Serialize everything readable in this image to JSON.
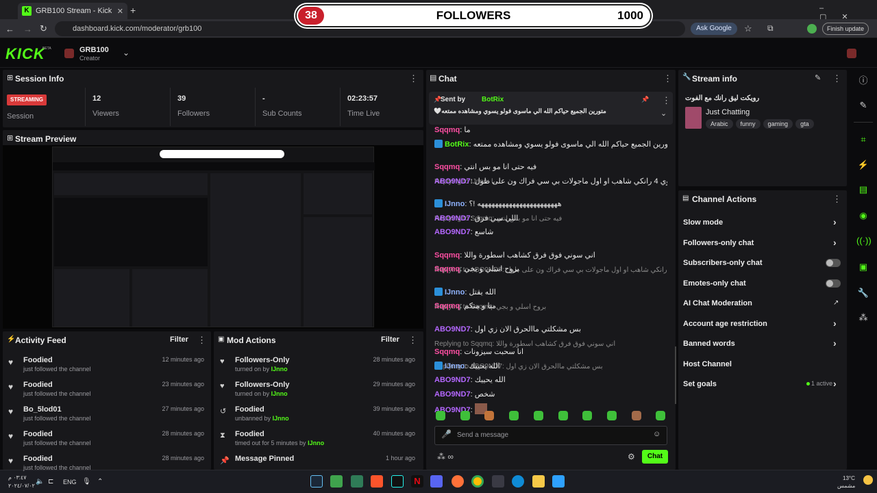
{
  "browser": {
    "tab_title": "GRB100 Stream - Kick Dashboard",
    "url": "dashboard.kick.com/moderator/grb100",
    "ask_google": "Ask Google",
    "finish_update": "Finish update"
  },
  "overlay": {
    "count": "38",
    "label": "FOLLOWERS",
    "goal": "1000"
  },
  "header": {
    "logo": "KICK",
    "logo_sub": "BETA",
    "channel": "GRB100",
    "role": "Creator"
  },
  "session": {
    "title": "Session Info",
    "status": "STREAMING",
    "session_label": "Session",
    "stats": [
      {
        "value": "12",
        "label": "Viewers"
      },
      {
        "value": "39",
        "label": "Followers"
      },
      {
        "value": "-",
        "label": "Sub Counts"
      },
      {
        "value": "02:23:57",
        "label": "Time Live"
      }
    ]
  },
  "preview": {
    "title": "Stream Preview"
  },
  "activity": {
    "title": "Activity Feed",
    "filter": "Filter",
    "items": [
      {
        "name": "Foodied",
        "desc": "just followed the channel",
        "time": "12 minutes ago"
      },
      {
        "name": "Foodied",
        "desc": "just followed the channel",
        "time": "23 minutes ago"
      },
      {
        "name": "Bo_5lod01",
        "desc": "just followed the channel",
        "time": "27 minutes ago"
      },
      {
        "name": "Foodied",
        "desc": "just followed the channel",
        "time": "28 minutes ago"
      },
      {
        "name": "Foodied",
        "desc": "just followed the channel",
        "time": "28 minutes ago"
      }
    ]
  },
  "mod": {
    "title": "Mod Actions",
    "filter": "Filter",
    "items": [
      {
        "name": "Followers-Only",
        "desc": "turned on by",
        "by": "IJnno",
        "time": "28 minutes ago"
      },
      {
        "name": "Followers-Only",
        "desc": "turned on by",
        "by": "IJnno",
        "time": "29 minutes ago"
      },
      {
        "name": "Foodied",
        "desc": "unbanned by",
        "by": "IJnno",
        "time": "39 minutes ago"
      },
      {
        "name": "Foodied",
        "desc": "timed out for 5 minutes by",
        "by": "IJnno",
        "time": "40 minutes ago"
      },
      {
        "name": "Message Pinned",
        "desc": "",
        "by": "",
        "time": "1 hour ago"
      }
    ]
  },
  "chat": {
    "title": "Chat",
    "pinned_by_label": "Sent by",
    "pinned_user": "BotRix",
    "pinned_text": "متورين الجميع حياكم الله الي ماسوى فولو يسوي ومشاهده ممتعه🤍",
    "messages": [
      {
        "type": "msg",
        "user": "Sqqmq",
        "cls": "u-pink",
        "text": "ما"
      },
      {
        "type": "msg",
        "user": "BotRix",
        "cls": "u-green",
        "text": "متورين الجميع حياكم الله الي ماسوى فولو يسوي ومشاهده ممتعه🤍"
      },
      {
        "type": "reply",
        "text": "Replying to IJnno: يا"
      },
      {
        "type": "msg",
        "user": "Sqqmq",
        "cls": "u-pink",
        "text": "فيه حتى انا مو بس انتي"
      },
      {
        "type": "msg",
        "user": "ABO9ND7",
        "cls": "u-purple",
        "text": "انا كنت سوي 4 رانكي شاهب او اول ماجولات بي سي فراك ون على طول"
      },
      {
        "type": "reply",
        "text": "Replying to Sqqmq: فيه حتى انا مو بس انتي"
      },
      {
        "type": "msg",
        "user": "IJnno",
        "cls": "u-blue",
        "text": "هههههههههههههههههههههههه !؟"
      },
      {
        "type": "msg",
        "user": "ABO9ND7",
        "cls": "u-purple",
        "text": "اللي سي فرق"
      },
      {
        "type": "msg",
        "user": "ABO9ND7",
        "cls": "u-purple",
        "text": "شاسع"
      },
      {
        "type": "reply",
        "text": "Replying to ABO9ND7: انا كنت سوي 4 رانكي شاهب او اول ماجولات بي سي فراك ون على طول"
      },
      {
        "type": "msg",
        "user": "Sqqmq",
        "cls": "u-pink",
        "text": "اني سوني فوق فرق كشاهب اسطورة واللا"
      },
      {
        "type": "msg",
        "user": "Sqqmq",
        "cls": "u-pink",
        "text": "بروح اسلي و بجي"
      },
      {
        "type": "reply",
        "text": "Replying to Sqqmq: بروح اسلي و بجي"
      },
      {
        "type": "msg",
        "user": "IJnno",
        "cls": "u-blue",
        "text": "الله يقتل"
      },
      {
        "type": "msg",
        "user": "Sqqmq",
        "cls": "u-pink",
        "text": "منا و منكم"
      },
      {
        "type": "reply",
        "text": "Replying to Sqqmq: اني سوني فوق فرق كشاهب اسطورة واللا"
      },
      {
        "type": "msg",
        "user": "ABO9ND7",
        "cls": "u-purple",
        "text": "بس مشكلتي ماالحرق الان زي اول"
      },
      {
        "type": "reply",
        "text": "Replying to ABO9ND7: بس مشكلتي ماالحرق الان زي اول"
      },
      {
        "type": "msg",
        "user": "Sqqmq",
        "cls": "u-pink",
        "text": "انا سحبت سيزونات"
      },
      {
        "type": "msg",
        "user": "IJnno",
        "cls": "u-blue",
        "text": "الله يحييك"
      },
      {
        "type": "msg",
        "user": "ABO9ND7",
        "cls": "u-purple",
        "text": "الله يحييك"
      },
      {
        "type": "msg",
        "user": "ABO9ND7",
        "cls": "u-purple",
        "text": "شخص"
      },
      {
        "type": "msg",
        "user": "ABO9ND7",
        "cls": "u-purple",
        "text": ""
      }
    ],
    "input_placeholder": "Send a message",
    "send": "Chat"
  },
  "stream_info": {
    "title": "Stream info",
    "stream_title": "رويكت ليق رانك مع الفوت",
    "category": "Just Chatting",
    "tags": [
      "Arabic",
      "funny",
      "gaming",
      "gta"
    ]
  },
  "channel_actions": {
    "title": "Channel Actions",
    "items": [
      {
        "label": "Slow mode",
        "kind": "chevron"
      },
      {
        "label": "Followers-only chat",
        "kind": "chevron"
      },
      {
        "label": "Subscribers-only chat",
        "kind": "toggle"
      },
      {
        "label": "Emotes-only chat",
        "kind": "toggle"
      },
      {
        "label": "AI Chat Moderation",
        "kind": "external"
      },
      {
        "label": "Account age restriction",
        "kind": "chevron"
      },
      {
        "label": "Banned words",
        "kind": "chevron"
      },
      {
        "label": "Host Channel",
        "kind": "none"
      },
      {
        "label": "Set goals",
        "kind": "chevron",
        "status": "1 active"
      }
    ]
  },
  "taskbar": {
    "time": "٠٣:٤٧ م",
    "date": "٢٠٢٤/٠٧/٠٢",
    "lang": "ENG",
    "weather_temp": "13°C",
    "weather_desc": "مشمس"
  },
  "colors": {
    "accent": "#53fc18",
    "streaming": "#d93a3a",
    "panel": "#18181b"
  }
}
